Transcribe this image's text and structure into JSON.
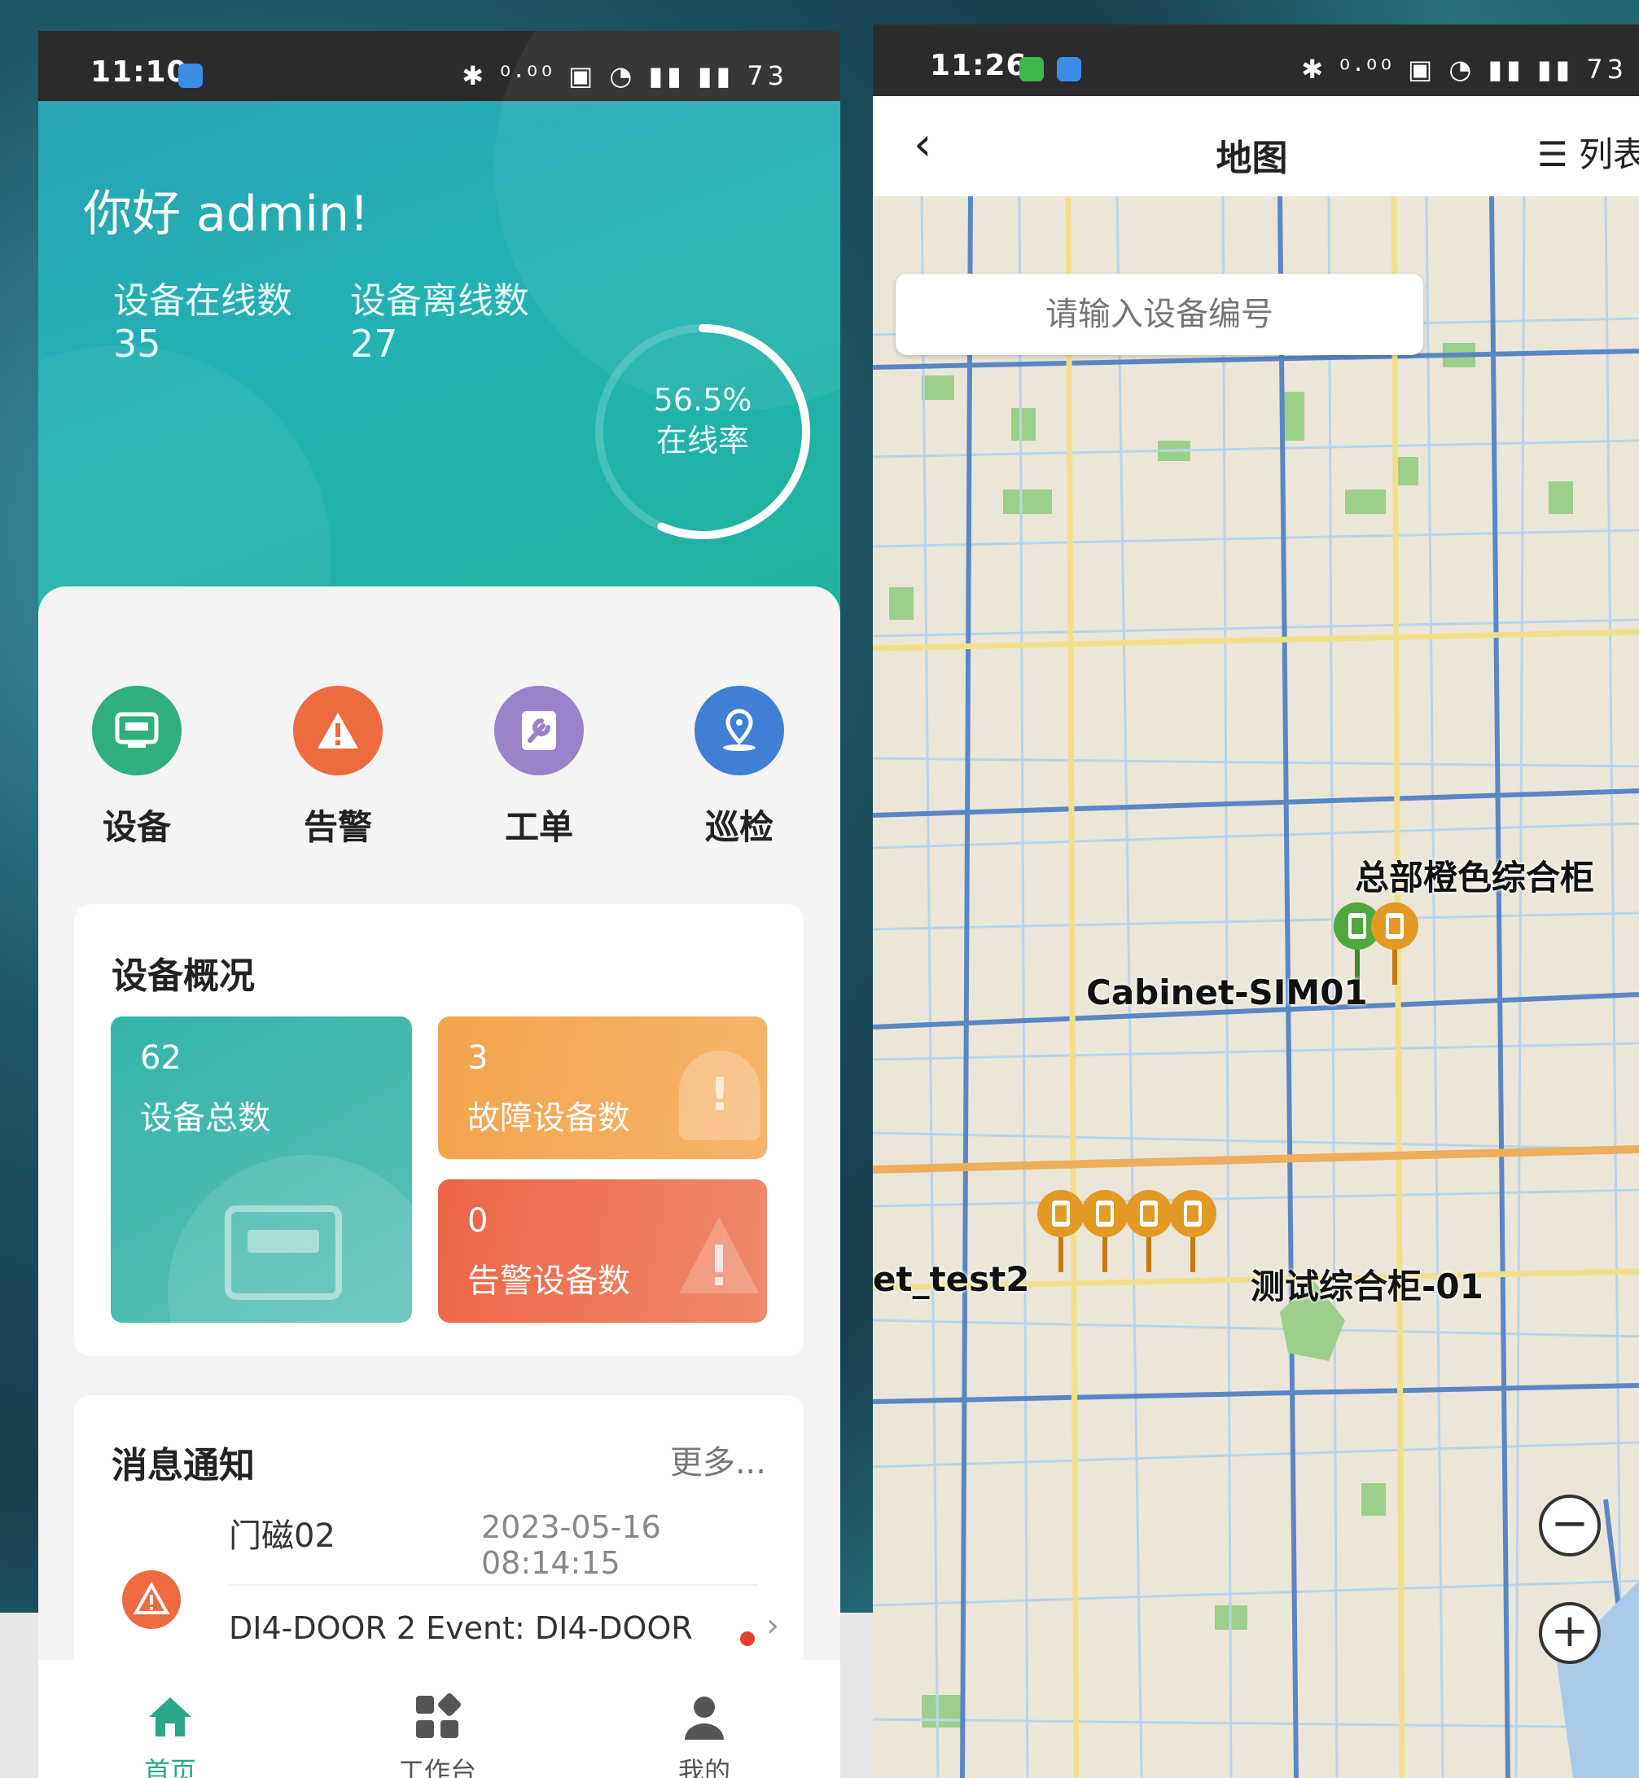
{
  "left_phone": {
    "status_bar": {
      "time": "11:10",
      "icons": "✱ ⁰·⁰⁰ ▣ ◔ ▮▮ ▮▮ 73"
    },
    "header": {
      "greeting": "你好 admin!",
      "online_label": "设备在线数",
      "online_value": "35",
      "offline_label": "设备离线数",
      "offline_value": "27",
      "online_rate_value": "56.5%",
      "online_rate_label": "在线率",
      "online_rate_fraction": 0.565
    },
    "quick_actions": [
      {
        "label": "设备",
        "icon": "device-icon",
        "color": "#2fae7e"
      },
      {
        "label": "告警",
        "icon": "warning-icon",
        "color": "#ee6a3f"
      },
      {
        "label": "工单",
        "icon": "wrench-icon",
        "color": "#9b82c9"
      },
      {
        "label": "巡检",
        "icon": "location-pin-icon",
        "color": "#3f7fd6"
      }
    ],
    "overview": {
      "title": "设备概况",
      "total": {
        "value": "62",
        "label": "设备总数",
        "color": "#2eb2a2"
      },
      "fault": {
        "value": "3",
        "label": "故障设备数",
        "color": "#f3a34c"
      },
      "alarm": {
        "value": "0",
        "label": "告警设备数",
        "color": "#ee6b4b"
      }
    },
    "messages": {
      "title": "消息通知",
      "more": "更多...",
      "items": [
        {
          "name": "门磁02",
          "time": "2023-05-16 08:14:15",
          "detail": "DI4-DOOR 2 Event:  DI4-DOOR"
        }
      ]
    },
    "nav": [
      {
        "label": "首页",
        "icon": "home-icon",
        "active": true
      },
      {
        "label": "工作台",
        "icon": "workbench-icon",
        "active": false
      },
      {
        "label": "我的",
        "icon": "profile-icon",
        "active": false
      }
    ],
    "colors": {
      "accent": "#2aa68a",
      "header_start": "#2aa3b5",
      "header_end": "#1fb39c"
    }
  },
  "right_phone": {
    "status_bar": {
      "time": "11:26",
      "icons": "✱ ⁰·⁰⁰ ▣ ◔ ▮▮ ▮▮ 73"
    },
    "header": {
      "back": "‹",
      "title": "地图",
      "list": "☰ 列表"
    },
    "search": {
      "placeholder": "请输入设备编号"
    },
    "markers": [
      {
        "label": "总部橙色综合柜"
      },
      {
        "label": "Cabinet-SIM01"
      },
      {
        "label": "et_test2"
      },
      {
        "label": "测试综合柜-01"
      }
    ],
    "zoom_out": "−",
    "zoom_in": "+"
  }
}
